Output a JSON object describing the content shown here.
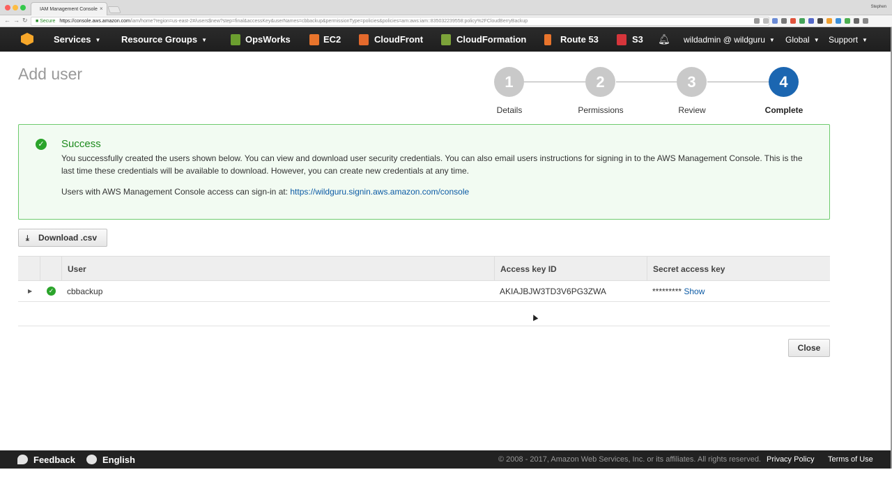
{
  "browser": {
    "tab_title": "IAM Management Console",
    "tab_close": "×",
    "profile": "Stephen",
    "secure_label": "Secure",
    "url_host": "https://console.aws.amazon.com",
    "url_rest": "/iam/home?region=us-east-2#/users$new?step=final&accessKey&userNames=cbbackup&permissionType=policies&policies=arn:aws:iam::835032239558:policy%2FCloudBerryBackup"
  },
  "aws_nav": {
    "services": "Services",
    "resource_groups": "Resource Groups",
    "shortcuts": [
      {
        "label": "OpsWorks",
        "color": "#6b9e2f"
      },
      {
        "label": "EC2",
        "color": "#e8742c"
      },
      {
        "label": "CloudFront",
        "color": "#e3692c"
      },
      {
        "label": "CloudFormation",
        "color": "#7ca33a"
      },
      {
        "label": "Route 53",
        "color": "#e8742c"
      },
      {
        "label": "S3",
        "color": "#d6353b"
      }
    ],
    "account": "wildadmin @ wildguru",
    "region": "Global",
    "support": "Support"
  },
  "page": {
    "title": "Add user",
    "steps": [
      {
        "number": "1",
        "label": "Details"
      },
      {
        "number": "2",
        "label": "Permissions"
      },
      {
        "number": "3",
        "label": "Review"
      },
      {
        "number": "4",
        "label": "Complete"
      }
    ],
    "active_step": 4
  },
  "success": {
    "title": "Success",
    "message": "You successfully created the users shown below. You can view and download user security credentials. You can also email users instructions for signing in to the AWS Management Console. This is the last time these credentials will be available to download. However, you can create new credentials at any time.",
    "signin_prefix": "Users with AWS Management Console access can sign-in at: ",
    "signin_url": "https://wildguru.signin.aws.amazon.com/console"
  },
  "actions": {
    "download_label": "Download .csv",
    "close_label": "Close"
  },
  "table": {
    "columns": [
      "User",
      "Access key ID",
      "Secret access key"
    ],
    "rows": [
      {
        "user": "cbbackup",
        "access_key_id": "AKIAJBJW3TD3V6PG3ZWA",
        "secret_masked": "*********",
        "show_label": "Show"
      }
    ]
  },
  "footer": {
    "feedback": "Feedback",
    "language": "English",
    "copyright": "© 2008 - 2017, Amazon Web Services, Inc. or its affiliates. All rights reserved.",
    "privacy": "Privacy Policy",
    "terms": "Terms of Use"
  },
  "colors": {
    "nav_bg": "#232323",
    "accent": "#1b66b1",
    "success": "#2ba42b",
    "link": "#0b5aa5"
  }
}
